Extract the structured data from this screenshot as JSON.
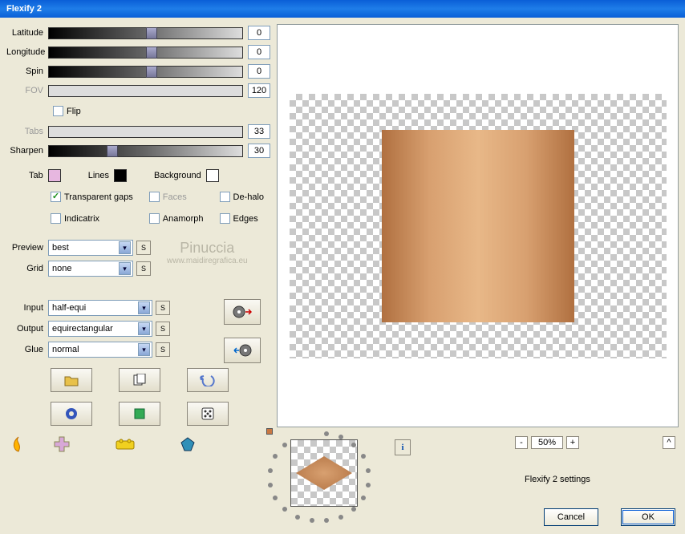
{
  "title": "Flexify 2",
  "sliders": {
    "latitude": {
      "label": "Latitude",
      "value": "0",
      "enabled": true,
      "thumb": 50
    },
    "longitude": {
      "label": "Longitude",
      "value": "0",
      "enabled": true,
      "thumb": 50
    },
    "spin": {
      "label": "Spin",
      "value": "0",
      "enabled": true,
      "thumb": 50
    },
    "fov": {
      "label": "FOV",
      "value": "120",
      "enabled": false,
      "thumb": 0
    },
    "tabs": {
      "label": "Tabs",
      "value": "33",
      "enabled": false,
      "thumb": 0
    },
    "sharpen": {
      "label": "Sharpen",
      "value": "30",
      "enabled": true,
      "thumb": 30
    }
  },
  "flip": {
    "label": "Flip",
    "checked": false
  },
  "colors": {
    "tab": {
      "label": "Tab",
      "hex": "#E7B7E0"
    },
    "lines": {
      "label": "Lines",
      "hex": "#000000"
    },
    "background": {
      "label": "Background",
      "hex": "#FFFFFF"
    }
  },
  "checks": {
    "transparent_gaps": {
      "label": "Transparent gaps",
      "checked": true,
      "dim": false
    },
    "faces": {
      "label": "Faces",
      "checked": false,
      "dim": true
    },
    "dehalo": {
      "label": "De-halo",
      "checked": false,
      "dim": false
    },
    "indicatrix": {
      "label": "Indicatrix",
      "checked": false,
      "dim": false
    },
    "anamorph": {
      "label": "Anamorph",
      "checked": false,
      "dim": false
    },
    "edges": {
      "label": "Edges",
      "checked": false,
      "dim": false
    }
  },
  "dropdowns": {
    "preview": {
      "label": "Preview",
      "value": "best"
    },
    "grid": {
      "label": "Grid",
      "value": "none"
    },
    "input": {
      "label": "Input",
      "value": "half-equi"
    },
    "output": {
      "label": "Output",
      "value": "equirectangular"
    },
    "glue": {
      "label": "Glue",
      "value": "normal"
    }
  },
  "watermark": {
    "line1": "Pinuccia",
    "line2": "www.maidiregrafica.eu"
  },
  "zoom": {
    "minus": "-",
    "plus": "+",
    "value": "50%",
    "collapse": "^"
  },
  "settings_label": "Flexify 2 settings",
  "buttons": {
    "cancel": "Cancel",
    "ok": "OK"
  },
  "s_label": "S"
}
